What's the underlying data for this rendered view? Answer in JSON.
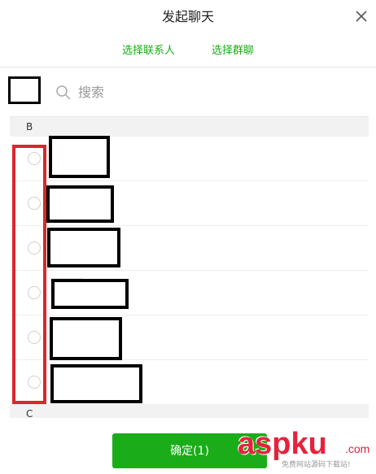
{
  "window": {
    "title": "发起聊天"
  },
  "tabs": [
    {
      "label": "选择联系人",
      "active": true
    },
    {
      "label": "选择群聊",
      "active": false
    }
  ],
  "search": {
    "placeholder": "搜索"
  },
  "sections": [
    {
      "letter": "B",
      "contacts_count": 6
    },
    {
      "letter": "C"
    }
  ],
  "confirm_button": {
    "label": "确定(1)"
  },
  "watermark": {
    "main": "aspku",
    "domain": ".com",
    "sub": "免费网站源码下载站!"
  },
  "colors": {
    "accent": "#1aad19",
    "highlight_frame": "#d9272e",
    "watermark": "#e5223c"
  },
  "icons": {
    "close": "close-icon",
    "search": "search-icon"
  }
}
